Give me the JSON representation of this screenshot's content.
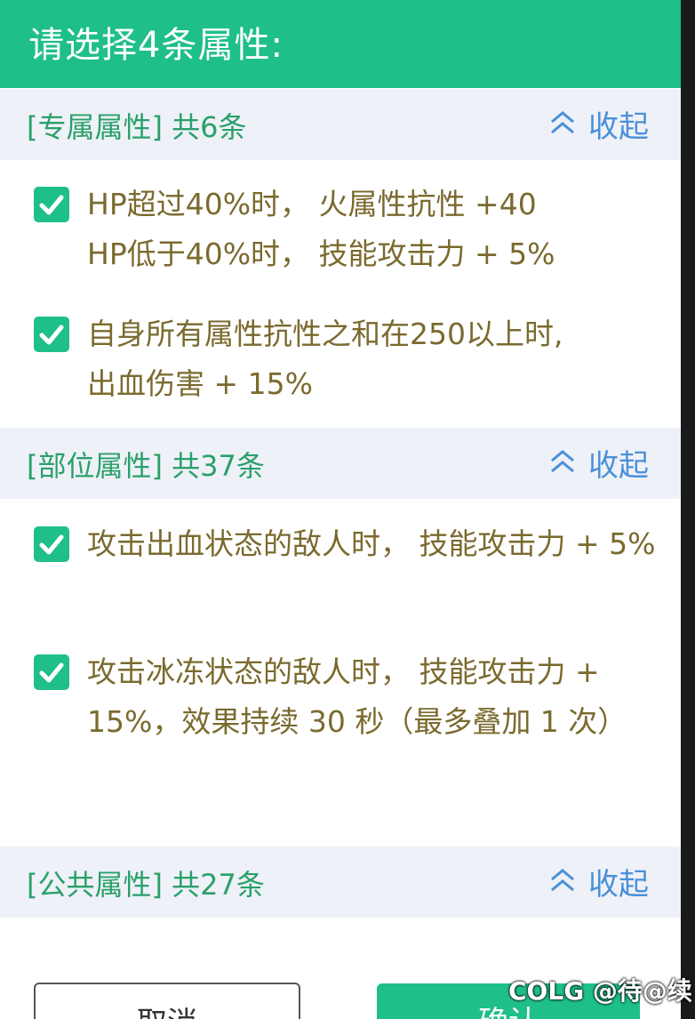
{
  "header": {
    "title": "请选择4条属性:"
  },
  "sections": [
    {
      "title": "[专属属性] 共6条",
      "collapse_label": "收起",
      "items": [
        {
          "lines": [
            "HP超过40%时， 火属性抗性 +40",
            "HP低于40%时， 技能攻击力 + 5%"
          ]
        },
        {
          "lines": [
            "自身所有属性抗性之和在250以上时,",
            "出血伤害 + 15%"
          ]
        }
      ]
    },
    {
      "title": "[部位属性] 共37条",
      "collapse_label": "收起",
      "items": [
        {
          "text": "攻击出血状态的敌人时， 技能攻击力 + 5%"
        },
        {
          "text": "攻击冰冻状态的敌人时， 技能攻击力 + 15%，效果持续 30 秒（最多叠加 1 次）"
        }
      ]
    },
    {
      "title": "[公共属性] 共27条",
      "collapse_label": "收起"
    }
  ],
  "footer": {
    "cancel_label": "取消",
    "confirm_label": "确认"
  },
  "watermark": "COLG @待@续",
  "colors": {
    "accent": "#1fbf8a",
    "section_bg": "#eef1f7",
    "link": "#4a90d9",
    "text": "#7a6a2e"
  }
}
